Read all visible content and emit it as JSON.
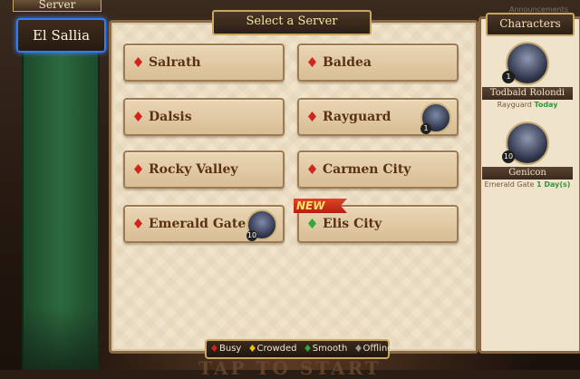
{
  "left": {
    "header": "Server",
    "selected": "El Sallia"
  },
  "title": "Select a Server",
  "servers": [
    {
      "name": "Salrath",
      "status": "busy"
    },
    {
      "name": "Baldea",
      "status": "busy"
    },
    {
      "name": "Dalsis",
      "status": "busy"
    },
    {
      "name": "Rayguard",
      "status": "busy",
      "char_level": "1"
    },
    {
      "name": "Rocky Valley",
      "status": "busy"
    },
    {
      "name": "Carmen City",
      "status": "busy"
    },
    {
      "name": "Emerald Gate",
      "status": "busy",
      "char_level": "10"
    },
    {
      "name": "Elis City",
      "status": "smooth",
      "badge": "NEW"
    }
  ],
  "characters": {
    "title": "Characters",
    "list": [
      {
        "name": "Todbald Rolondi",
        "server": "Rayguard",
        "last": "Today",
        "level": "1"
      },
      {
        "name": "Genicon",
        "server": "Emerald Gate",
        "last": "1 Day(s)",
        "level": "10"
      }
    ]
  },
  "legend": [
    {
      "label": "Busy",
      "color": "#d0251a"
    },
    {
      "label": "Crowded",
      "color": "#e8c21a"
    },
    {
      "label": "Smooth",
      "color": "#2fa83a"
    },
    {
      "label": "Offline",
      "color": "#9a9a9a"
    }
  ],
  "footer": "TAP TO START",
  "corner_text": "Announcements"
}
